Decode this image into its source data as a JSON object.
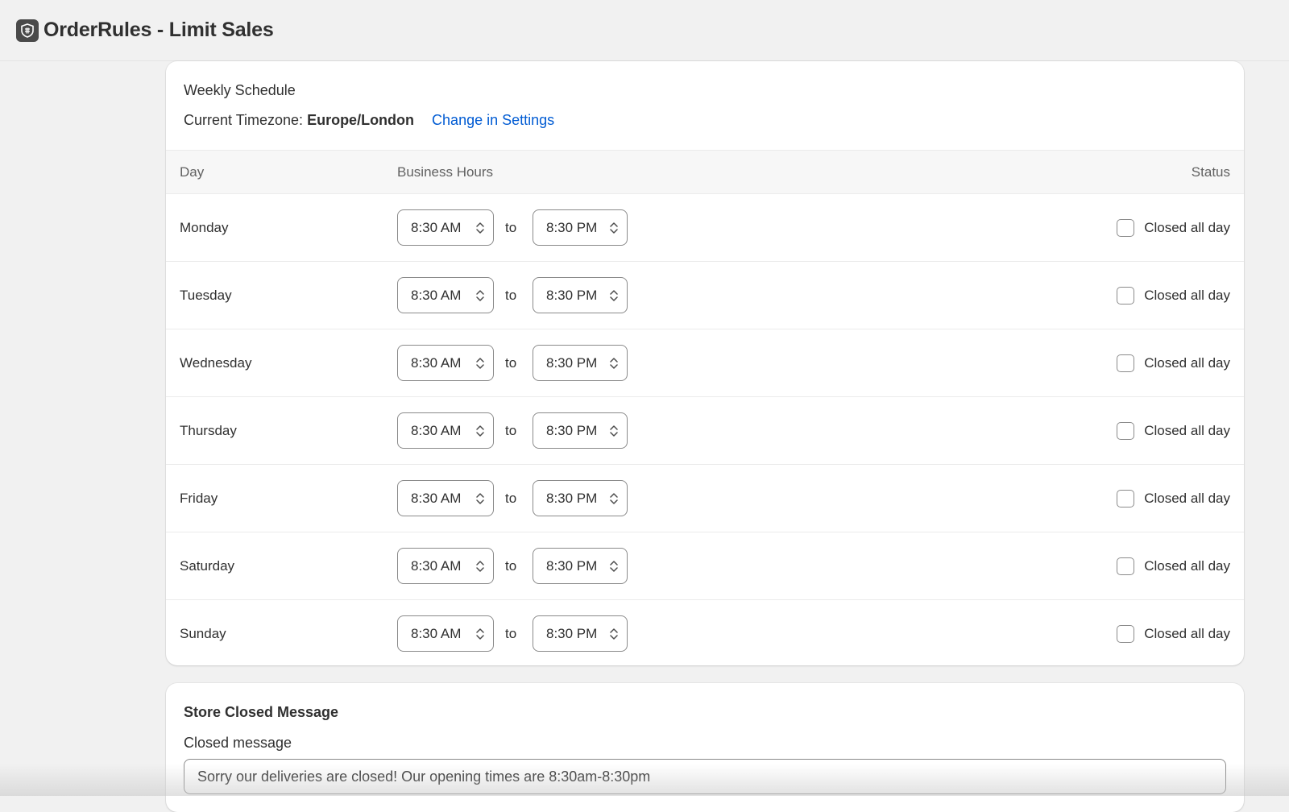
{
  "app": {
    "title": "OrderRules - Limit Sales",
    "logo_icon": "shield-logo-icon"
  },
  "schedule": {
    "title": "Weekly Schedule",
    "timezone_label": "Current Timezone:",
    "timezone_value": "Europe/London",
    "change_link": "Change in Settings",
    "columns": {
      "day": "Day",
      "hours": "Business Hours",
      "status": "Status"
    },
    "to_label": "to",
    "closed_label": "Closed all day",
    "days": [
      {
        "name": "Monday",
        "open": "8:30 AM",
        "close": "8:30 PM",
        "closed_all_day": false
      },
      {
        "name": "Tuesday",
        "open": "8:30 AM",
        "close": "8:30 PM",
        "closed_all_day": false
      },
      {
        "name": "Wednesday",
        "open": "8:30 AM",
        "close": "8:30 PM",
        "closed_all_day": false
      },
      {
        "name": "Thursday",
        "open": "8:30 AM",
        "close": "8:30 PM",
        "closed_all_day": false
      },
      {
        "name": "Friday",
        "open": "8:30 AM",
        "close": "8:30 PM",
        "closed_all_day": false
      },
      {
        "name": "Saturday",
        "open": "8:30 AM",
        "close": "8:30 PM",
        "closed_all_day": false
      },
      {
        "name": "Sunday",
        "open": "8:30 AM",
        "close": "8:30 PM",
        "closed_all_day": false
      }
    ]
  },
  "store_closed": {
    "title": "Store Closed Message",
    "field_label": "Closed message",
    "field_value": "Sorry our deliveries are closed! Our opening times are 8:30am-8:30pm"
  },
  "colors": {
    "link": "#005bd3",
    "background": "#f1f1f1",
    "card": "#ffffff"
  }
}
